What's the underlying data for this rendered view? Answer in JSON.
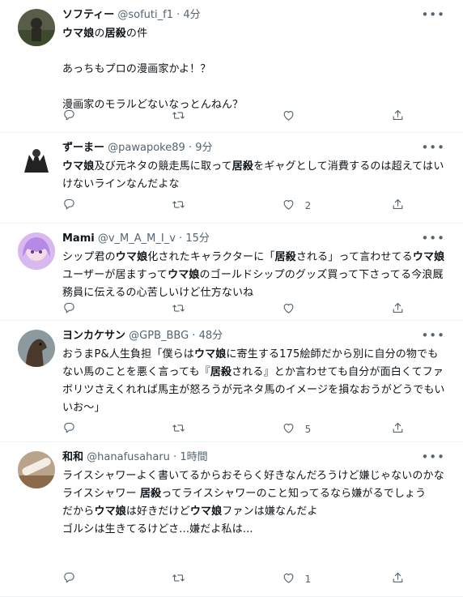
{
  "tweets": [
    {
      "name": "ソフティー",
      "handle": "@sofuti_f1",
      "time": "4分",
      "body": [
        [
          "b",
          "ウマ娘"
        ],
        [
          "t",
          "の"
        ],
        [
          "b",
          "居殺"
        ],
        [
          "t",
          "の件\n\nあっちもプロの漫画家かよ！？\n\n漫画家のモラルどないなっとんねん？"
        ]
      ],
      "reply_count": "",
      "retweet_count": "",
      "like_count": "",
      "avatar_color": "#5a5c4a"
    },
    {
      "name": "ずーまー",
      "handle": "@pawapoke89",
      "time": "9分",
      "body": [
        [
          "b",
          "ウマ娘"
        ],
        [
          "t",
          "及び元ネタの競走馬に取って"
        ],
        [
          "b",
          "居殺"
        ],
        [
          "t",
          "をギャグとして消費するのは超えてはいけないラインなんだよな"
        ]
      ],
      "reply_count": "",
      "retweet_count": "",
      "like_count": "2",
      "avatar_color": "#ffffff"
    },
    {
      "name": "Mami",
      "handle": "@v_M_A_M_I_v",
      "time": "15分",
      "body": [
        [
          "t",
          "シップ君の"
        ],
        [
          "b",
          "ウマ娘"
        ],
        [
          "t",
          "化されたキャラクターに「"
        ],
        [
          "b",
          "居殺"
        ],
        [
          "t",
          "される」って言わせてる"
        ],
        [
          "b",
          "ウマ娘"
        ],
        [
          "t",
          "ユーザーが居ますって"
        ],
        [
          "b",
          "ウマ娘"
        ],
        [
          "t",
          "のゴールドシップのグッズ買って下さってる今浪厩務員に伝えるの心苦しいけど仕方ないね"
        ]
      ],
      "reply_count": "",
      "retweet_count": "",
      "like_count": "",
      "avatar_color": "#d9b8f0"
    },
    {
      "name": "ヨンカケサン",
      "handle": "@GPB_BBG",
      "time": "48分",
      "body": [
        [
          "t",
          "おうまP&人生負担「僕らは"
        ],
        [
          "b",
          "ウマ娘"
        ],
        [
          "t",
          "に寄生する175絵師だから別に自分の物でもない馬のことを悪く言っても『"
        ],
        [
          "b",
          "居殺"
        ],
        [
          "t",
          "される』とか言わせても自分が面白くてファボリツさえくれれば馬主が怒ろうが元ネタ馬のイメージを損なおうがどうでもいいお〜」"
        ]
      ],
      "reply_count": "",
      "retweet_count": "",
      "like_count": "5",
      "avatar_color": "#4a3a2c"
    },
    {
      "name": "和和",
      "handle": "@hanafusaharu",
      "time": "1時間",
      "body": [
        [
          "t",
          "ライスシャワーよく書いてるからおそらく好きなんだろうけど嫌じゃないのかな\nライスシャワー "
        ],
        [
          "b",
          "居殺"
        ],
        [
          "t",
          "ってライスシャワーのこと知ってるなら嫌がるでしょう\nだから"
        ],
        [
          "b",
          "ウマ娘"
        ],
        [
          "t",
          "は好きだけど"
        ],
        [
          "b",
          "ウマ娘"
        ],
        [
          "t",
          "ファンは嫌なんだよ\nゴルシは生きてるけどさ...嫌だよ私は..."
        ]
      ],
      "reply_count": "",
      "retweet_count": "",
      "like_count": "1",
      "avatar_color": "#8a6a4a"
    }
  ]
}
